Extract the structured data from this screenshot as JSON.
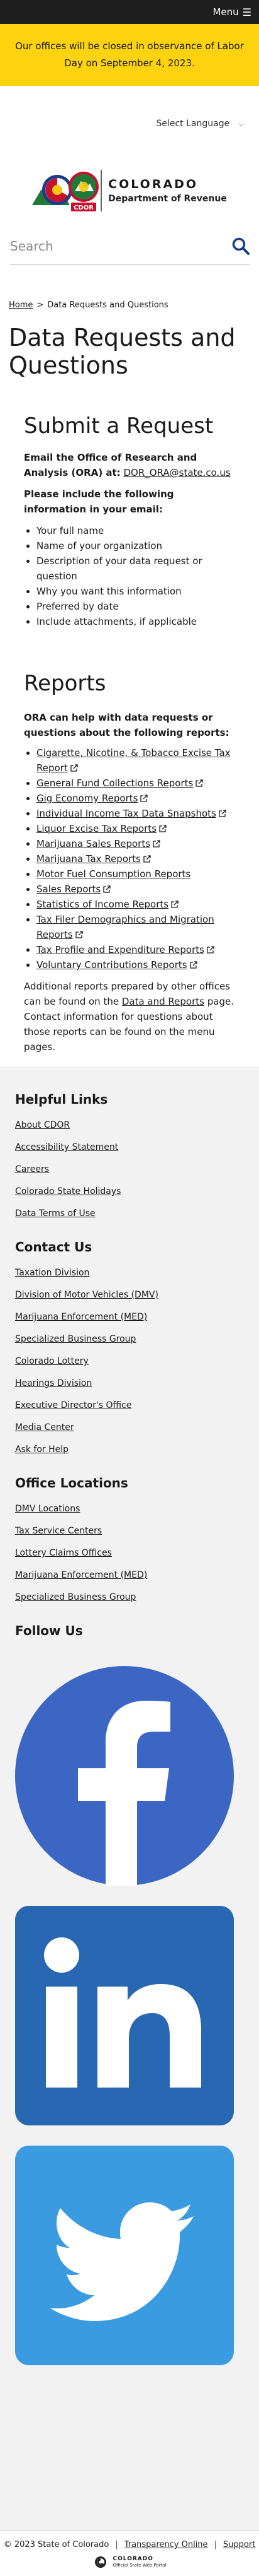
{
  "menu": {
    "label": "Menu"
  },
  "alert": {
    "text": "Our offices will be closed in observance of Labor Day on September 4, 2023."
  },
  "language": {
    "label": "Select Language"
  },
  "logo": {
    "line1": "COLORADO",
    "line2": "Department of Revenue",
    "badge": "CDOR"
  },
  "search": {
    "placeholder": "Search"
  },
  "breadcrumb": {
    "home": "Home",
    "separator": ">",
    "current": "Data Requests and Questions"
  },
  "page": {
    "title": "Data Requests and Questions"
  },
  "submit": {
    "heading": "Submit a Request",
    "email_intro": "Email the Office of Research and Analysis (ORA) at:",
    "email": "DOR_ORA@state.co.us",
    "include_text": "Please include the following information in your email:",
    "items": [
      "Your full name",
      "Name of your organization",
      "Description of your data request or question",
      "Why you want this information",
      "Preferred by date",
      "Include attachments, if applicable"
    ]
  },
  "reports": {
    "heading": "Reports",
    "intro": "ORA can help with data requests or questions about the following reports:",
    "items": [
      {
        "label": "Cigarette, Nicotine, & Tobacco Excise Tax Report",
        "external": true
      },
      {
        "label": "General Fund Collections Reports",
        "external": true
      },
      {
        "label": "Gig Economy Reports",
        "external": true
      },
      {
        "label": "Individual Income Tax Data Snapshots",
        "external": true
      },
      {
        "label": "Liquor Excise Tax Reports",
        "external": true
      },
      {
        "label": "Marijuana Sales Reports",
        "external": true
      },
      {
        "label": "Marijuana Tax Reports",
        "external": true
      },
      {
        "label": "Motor Fuel Consumption Reports",
        "external": false
      },
      {
        "label": "Sales Reports",
        "external": true
      },
      {
        "label": "Statistics of Income Reports",
        "external": true
      },
      {
        "label": "Tax Filer Demographics and Migration Reports",
        "external": true
      },
      {
        "label": "Tax Profile and Expenditure Reports",
        "external": true
      },
      {
        "label": "Voluntary Contributions Reports",
        "external": true
      }
    ],
    "outro_1": "Additional reports prepared by other offices can be found on the",
    "outro_link": "Data and Reports",
    "outro_2": "page. Contact information for questions about those reports can be found on the menu pages."
  },
  "footer": {
    "helpful": {
      "heading": "Helpful Links",
      "links": [
        "About CDOR",
        "Accessibility Statement",
        "Careers",
        "Colorado State Holidays",
        "Data Terms of Use"
      ]
    },
    "contact": {
      "heading": "Contact Us",
      "links": [
        "Taxation Division",
        "Division of Motor Vehicles (DMV)",
        "Marijuana Enforcement (MED)",
        "Specialized Business Group",
        "Colorado Lottery",
        "Hearings Division",
        "Executive Director's Office",
        "Media Center",
        "Ask for Help"
      ]
    },
    "offices": {
      "heading": "Office Locations",
      "links": [
        "DMV Locations",
        "Tax Service Centers",
        "Lottery Claims Offices",
        "Marijuana Enforcement (MED)",
        "Specialized Business Group"
      ]
    },
    "follow": {
      "heading": "Follow Us",
      "icons": [
        "facebook-icon",
        "linkedin-icon",
        "twitter-icon"
      ]
    }
  },
  "bottom": {
    "copyright": "© 2023 State of Colorado",
    "sep": "|",
    "transparency": "Transparency Online",
    "support": "Support",
    "portal_title": "COLORADO",
    "portal_sub": "Official State Web Portal"
  },
  "colors": {
    "alert_bg": "#fcd30e",
    "menu_bg": "#1f1f1f",
    "facebook": "#3b66c4",
    "linkedin": "#2867b2",
    "twitter": "#3b9be0",
    "link_accent": "#1a1a8c"
  }
}
